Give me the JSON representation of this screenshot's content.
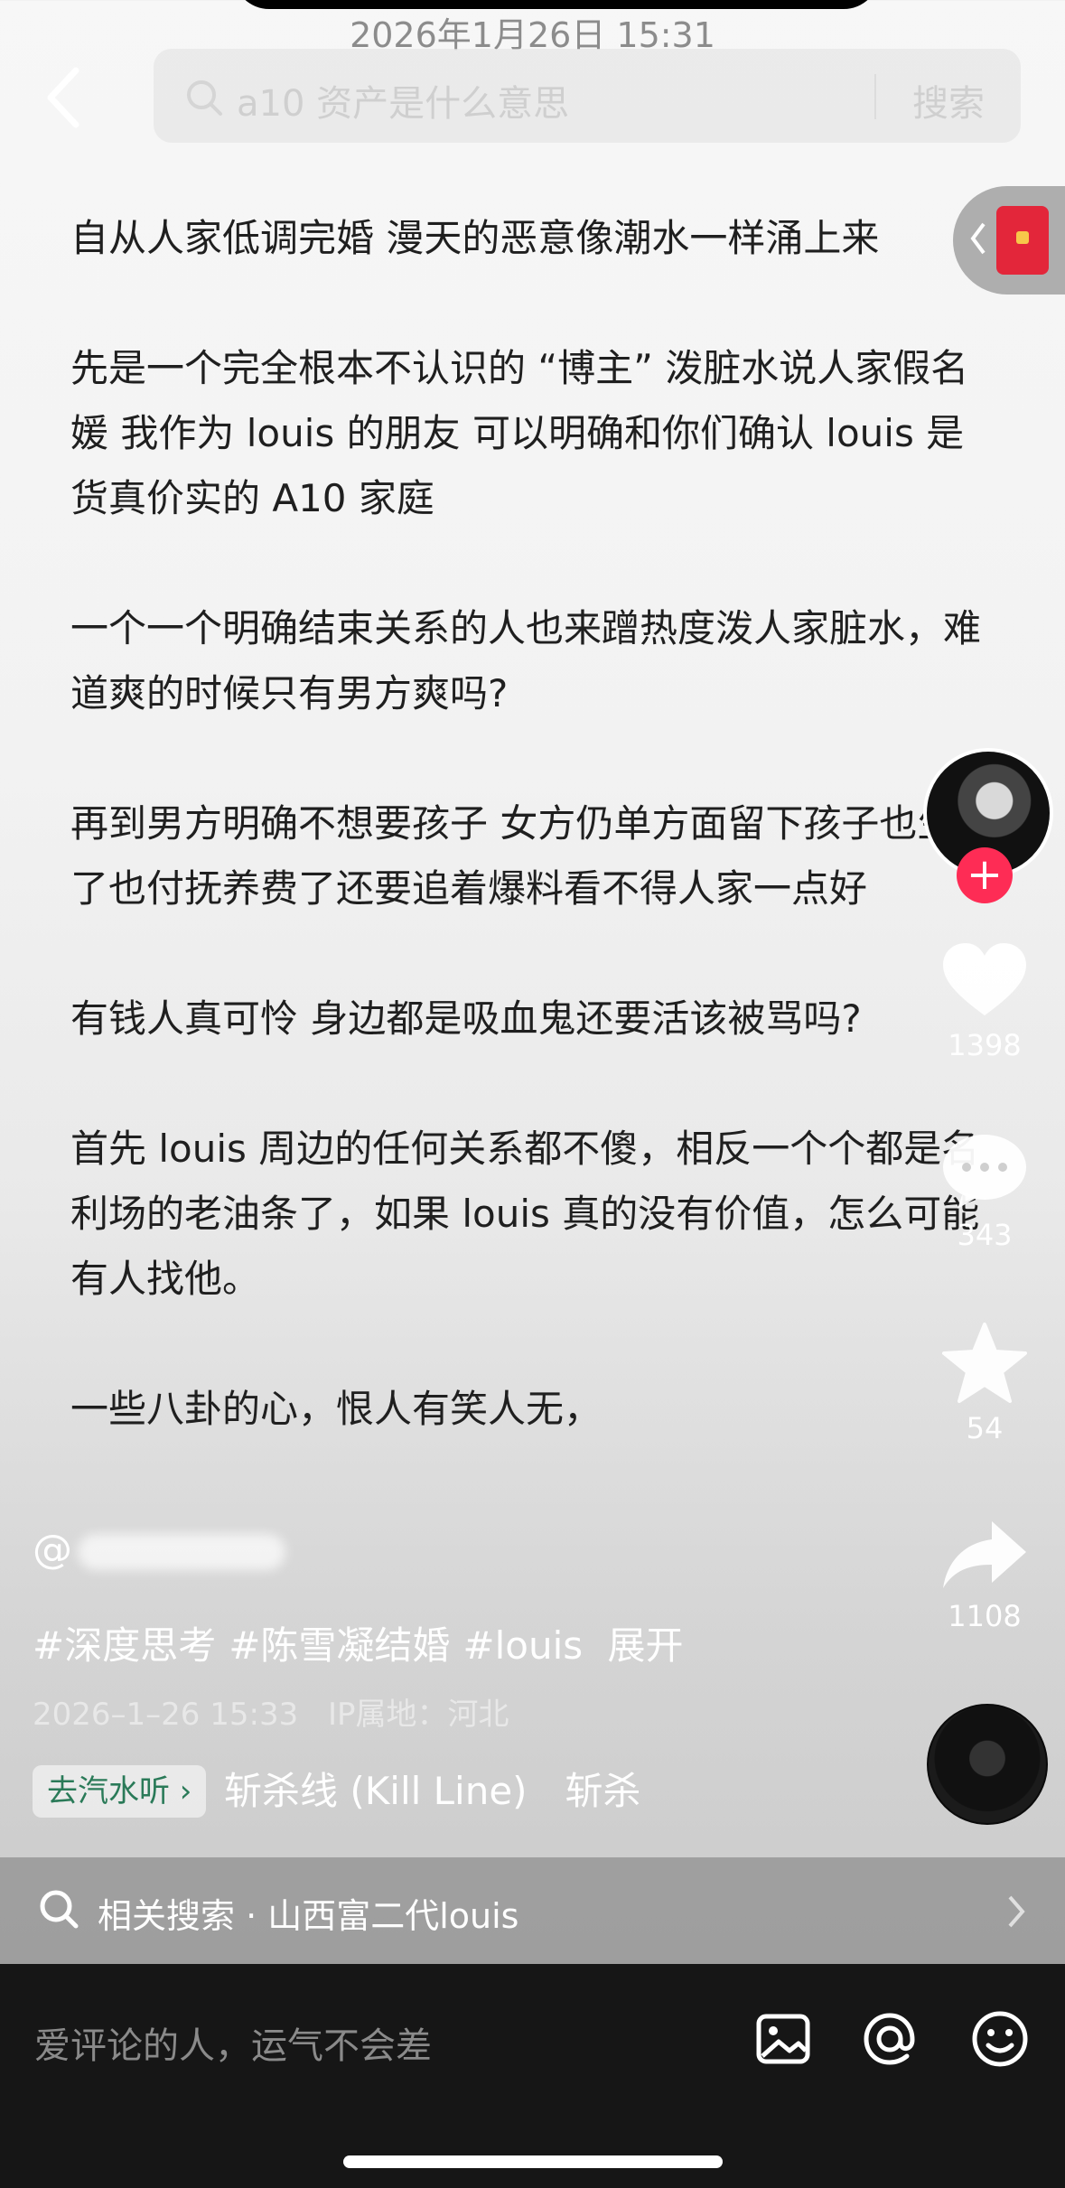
{
  "status": {
    "timestamp": "2026年1月26日 15:31"
  },
  "search": {
    "placeholder": "a10 资产是什么意思",
    "button": "搜索"
  },
  "article": {
    "paragraphs": [
      "自从人家低调完婚 漫天的恶意像潮水一样涌上来",
      "先是一个完全根本不认识的 “博主” 泼脏水说人家假名媛 我作为 louis 的朋友 可以明确和你们确认 louis 是货真价实的 A10 家庭",
      "一个一个明确结束关系的人也来蹭热度泼人家脏水，难道爽的时候只有男方爽吗?",
      "再到男方明确不想要孩子 女方仍单方面留下孩子也生了也付抚养费了还要追着爆料看不得人家一点好",
      "有钱人真可怜 身边都是吸血鬼还要活该被骂吗?",
      "首先 louis 周边的任何关系都不傻，相反一个个都是名利场的老油条了，如果 louis 真的没有价值，怎么可能有人找他。",
      "一些八卦的心，恨人有笑人无，"
    ]
  },
  "actions": {
    "likes": "1398",
    "comments": "343",
    "favorites": "54",
    "shares": "1108"
  },
  "author": {
    "at": "@"
  },
  "caption": {
    "tags": [
      "#深度思考",
      "#陈雪凝结婚",
      "#louis"
    ],
    "expand": "展开",
    "date": "2026–1–26 15:33",
    "ip": "IP属地：河北"
  },
  "music": {
    "pill": "去汽水听 ›",
    "title": "斩杀线 (Kill Line)　斩杀"
  },
  "related": {
    "label": "相关搜索 · 山西富二代louis"
  },
  "comment": {
    "placeholder": "爱评论的人，运气不会差"
  },
  "colors": {
    "accent_red": "#fe2c55",
    "music_green": "#2a7a58",
    "bottom_bar": "#161616"
  }
}
